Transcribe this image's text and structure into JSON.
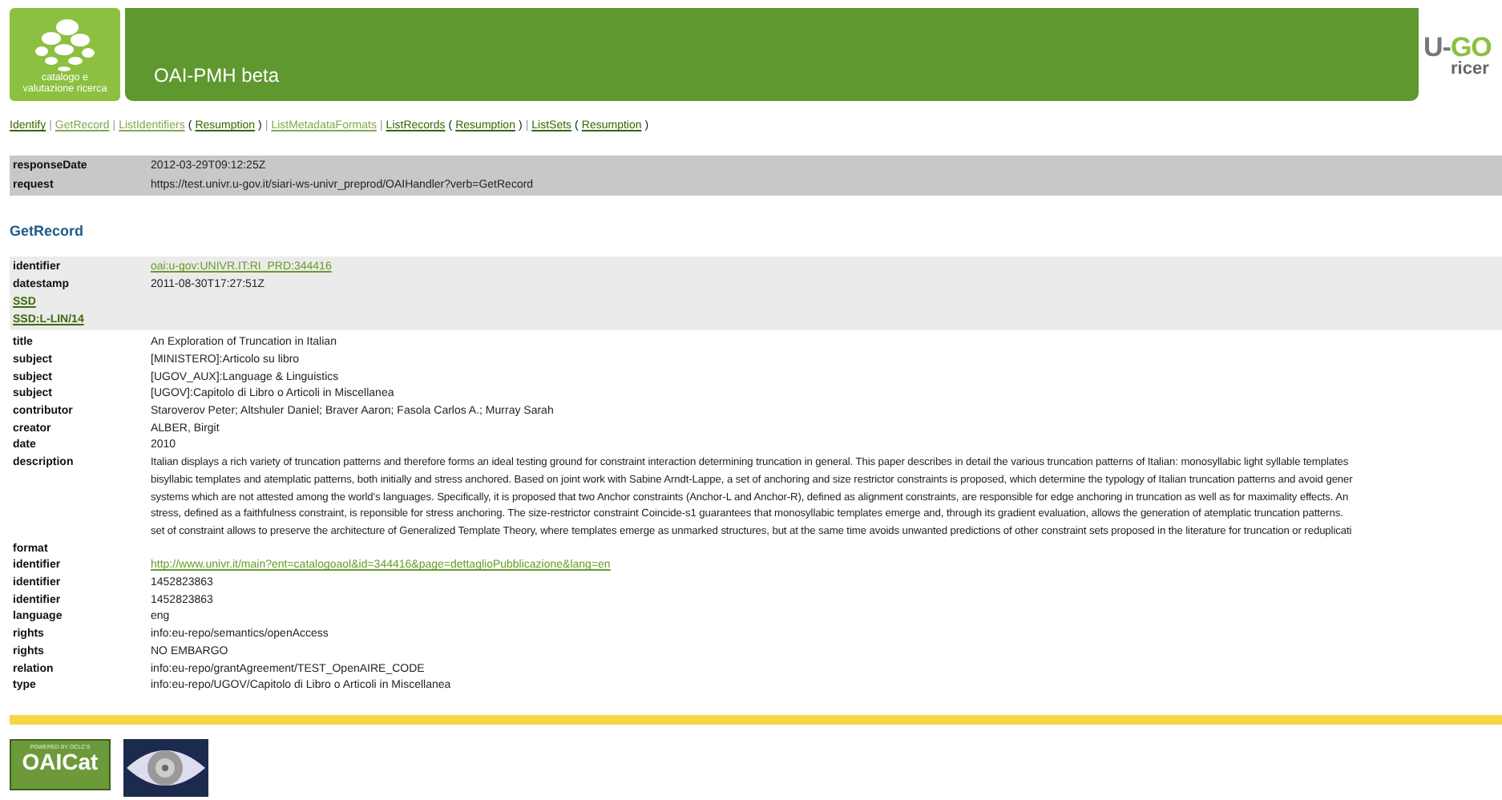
{
  "header": {
    "logo_text": [
      "catalogo e",
      "valutazione ricerca"
    ],
    "title": "OAI-PMH beta",
    "right_logo": {
      "mark_a": "U-",
      "mark_b": "GO",
      "sub": "ricer"
    }
  },
  "nav": [
    {
      "label": "Identify",
      "visited": false,
      "sep": "|"
    },
    {
      "label": "GetRecord",
      "visited": true,
      "sep": "|"
    },
    {
      "label": "ListIdentifiers",
      "visited": true,
      "open": "(",
      "resumption": "Resumption",
      "close": ")",
      "sep": "|"
    },
    {
      "label": "ListMetadataFormats",
      "visited": true,
      "sep": "|"
    },
    {
      "label": "ListRecords",
      "visited": false,
      "open": "(",
      "resumption": "Resumption",
      "close": ")",
      "sep": "|"
    },
    {
      "label": "ListSets",
      "visited": false,
      "open": "(",
      "resumption": "Resumption",
      "close": ")"
    }
  ],
  "response": [
    {
      "label": "responseDate",
      "value": "2012-03-29T09:12:25Z"
    },
    {
      "label": "request",
      "value": "https://test.univr.u-gov.it/siari-ws-univr_preprod/OAIHandler?verb=GetRecord"
    }
  ],
  "section_title": "GetRecord",
  "record_header": [
    {
      "kind": "link",
      "label": "identifier",
      "value": "oai:u-gov:UNIVR.IT:RI_PRD:344416"
    },
    {
      "kind": "text",
      "label": "datestamp",
      "value": "2011-08-30T17:27:51Z"
    },
    {
      "kind": "label-link",
      "label": "SSD"
    },
    {
      "kind": "label-link",
      "label": "SSD:L-LIN/14"
    }
  ],
  "metadata": [
    {
      "kind": "text",
      "label": "title",
      "value": "An Exploration of Truncation in Italian"
    },
    {
      "kind": "text",
      "label": "subject",
      "value": "[MINISTERO]:Articolo su libro"
    },
    {
      "kind": "text",
      "label": "subject",
      "value": "[UGOV_AUX]:Language & Linguistics"
    },
    {
      "kind": "text",
      "label": "subject",
      "value": "[UGOV]:Capitolo di Libro o Articoli in Miscellanea"
    },
    {
      "kind": "text",
      "label": "contributor",
      "value": "Staroverov Peter; Altshuler Daniel; Braver Aaron; Fasola Carlos A.; Murray Sarah"
    },
    {
      "kind": "text",
      "label": "creator",
      "value": "ALBER, Birgit"
    },
    {
      "kind": "text",
      "label": "date",
      "value": "2010"
    },
    {
      "kind": "lines",
      "label": "description",
      "lines": [
        "Italian displays a rich variety of truncation patterns and therefore forms an ideal testing ground for constraint interaction determining truncation in general.  This paper describes in detail the various truncation patterns of Italian: monosyllabic light syllable templates",
        "bisyllabic templates and atemplatic patterns, both initially and stress anchored. Based on joint work with Sabine Arndt-Lappe, a set of anchoring and size restrictor constraints is proposed, which determine the typology of Italian truncation patterns and avoid gener",
        "systems which are not attested among the world's languages. Specifically, it is proposed that two Anchor constraints (Anchor-L and Anchor-R), defined as alignment constraints, are responsible for edge anchoring in truncation as well as for maximality effects. An",
        "stress, defined as a faithfulness constraint, is reponsible for stress anchoring. The size-restrictor constraint Coincide-s1 guarantees that monosyllabic templates emerge and, through its gradient evaluation, allows the generation of atemplatic truncation patterns.",
        "set of constraint allows to preserve the architecture of Generalized Template Theory, where templates emerge as unmarked structures, but at the same time avoids unwanted predictions of other constraint sets proposed in the literature for truncation or reduplicati"
      ]
    },
    {
      "kind": "empty",
      "label": "format"
    },
    {
      "kind": "link",
      "label": "identifier",
      "value": "http://www.univr.it/main?ent=catalogoaol&id=344416&page=dettaglioPubblicazione&lang=en"
    },
    {
      "kind": "text",
      "label": "identifier",
      "value": "1452823863"
    },
    {
      "kind": "text",
      "label": "identifier",
      "value": "1452823863"
    },
    {
      "kind": "text",
      "label": "language",
      "value": "eng"
    },
    {
      "kind": "text",
      "label": "rights",
      "value": "info:eu-repo/semantics/openAccess"
    },
    {
      "kind": "text",
      "label": "rights",
      "value": "NO EMBARGO"
    },
    {
      "kind": "text",
      "label": "relation",
      "value": "info:eu-repo/grantAgreement/TEST_OpenAIRE_CODE"
    },
    {
      "kind": "text",
      "label": "type",
      "value": "info:eu-repo/UGOV/Capitolo di Libro o Articoli in Miscellanea"
    }
  ],
  "footer": {
    "badge_top": "POWERED BY OCLC'S",
    "badge_name": "OAICat"
  }
}
